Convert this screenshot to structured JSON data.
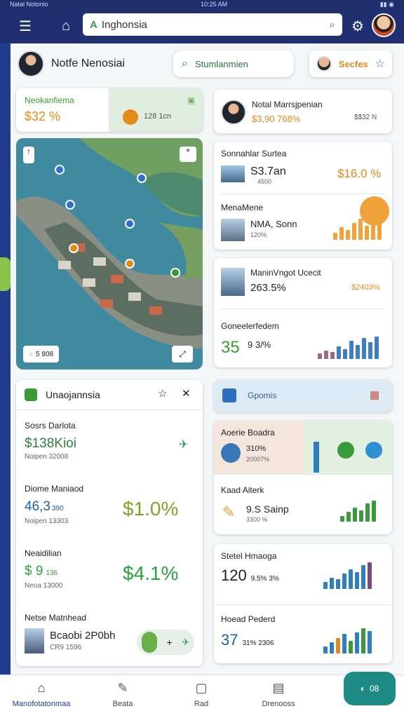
{
  "status": {
    "left": "Natal Notonio",
    "time": "10:25 AM"
  },
  "topbar": {
    "url": "Inghonsia"
  },
  "header": {
    "user_name": "Notfe Nenosiai",
    "search_pill": "Stumlanmien",
    "profile_btn": "Secfes"
  },
  "card_market": {
    "title": "Neokanfiema",
    "value": "$32 %",
    "side": "128 1cn"
  },
  "card_rental": {
    "title": "Notal Marrsjpenian",
    "value": "$3,90 768%",
    "side": "$$32 N"
  },
  "card_sonna": {
    "title": "Sonnahlar Surtea",
    "value": "S3.7an",
    "sub": "4500",
    "right": "$16.0 %"
  },
  "card_mana": {
    "title": "MenaMene",
    "value": "NMA, Sonn",
    "sub": "120%"
  },
  "card_manin": {
    "title": "ManinVngot Ucecit",
    "value": "263.5%",
    "right": "$2403%"
  },
  "card_gone": {
    "title": "Goneelerfedem",
    "value": "35",
    "sub": "9 3/%"
  },
  "map": {
    "badge": "5 808"
  },
  "list": {
    "title": "Unaojannsia",
    "rows": [
      {
        "title": "Sosrs Darlota",
        "value": "$138Kioi",
        "sub": "Noipen 32008",
        "right": ""
      },
      {
        "title": "Diome Maniaod",
        "value": "46,3",
        "value_small": "390",
        "sub": "Noipen 13303",
        "right": "$1.0%"
      },
      {
        "title": "Neaidilian",
        "value": "$ 9",
        "value_small": "136",
        "sub": "Neoa 13000",
        "right": "$4.1%"
      },
      {
        "title": "Netse Matnhead",
        "value": "Bcaobi 2P0bh",
        "sub": "CR9 1596",
        "right": ""
      }
    ]
  },
  "card_gonnis": {
    "title": "Gpomis"
  },
  "card_aoerie": {
    "title": "Aoerie Boadra",
    "value": "310%",
    "sub": "20007%"
  },
  "card_kaad": {
    "title": "Kaad Aiterk",
    "value": "9.S Sainp",
    "sub": "3300 %"
  },
  "card_stetel": {
    "title": "Stetel Hmaoga",
    "value": "120",
    "value_small": "9.5% 3%"
  },
  "card_hoead": {
    "title": "Hoead Pederd",
    "value": "37",
    "value_small": "31% 2306"
  },
  "nav": [
    {
      "label": "Manofotatonmaa"
    },
    {
      "label": "Beata"
    },
    {
      "label": "Rad"
    },
    {
      "label": "Drenooss"
    }
  ],
  "fab": {
    "label": "08"
  },
  "colors": {
    "brand": "#1f2f6f",
    "green": "#3a9a3a",
    "orange": "#e38a1a",
    "teal": "#1e8c84"
  }
}
